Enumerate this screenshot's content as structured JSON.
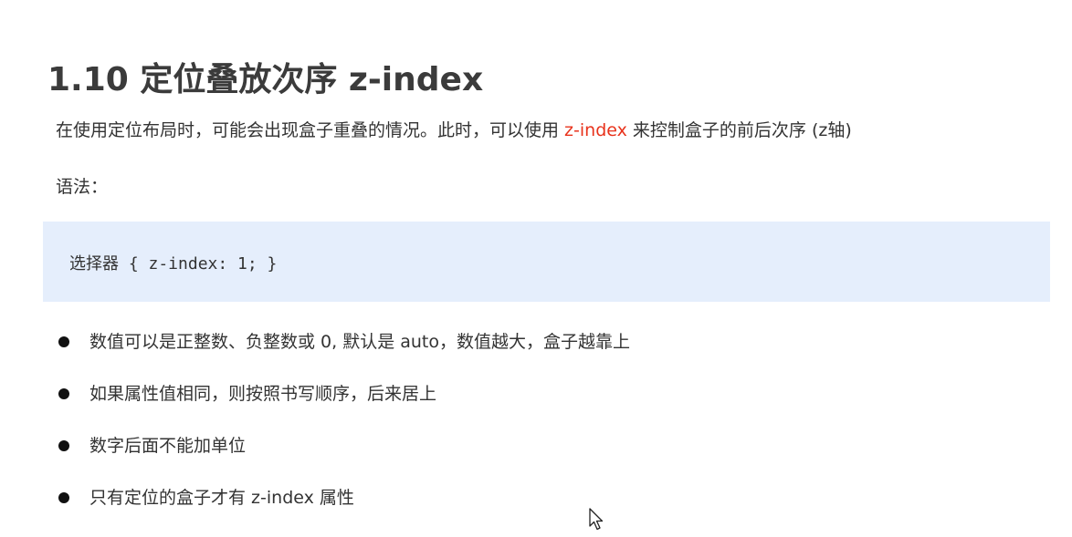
{
  "title": "1.10 定位叠放次序 z-index",
  "intro": {
    "before": "在使用定位布局时，可能会出现盒子重叠的情况。此时，可以使用 ",
    "highlight": "z-index",
    "after": " 来控制盒子的前后次序 (z轴)"
  },
  "syntax_label": "语法：",
  "code": "选择器 { z-index: 1; }",
  "bullets": [
    "数值可以是正整数、负整数或 0, 默认是 auto，数值越大，盒子越靠上",
    "如果属性值相同，则按照书写顺序，后来居上",
    "数字后面不能加单位",
    "只有定位的盒子才有 z-index 属性"
  ],
  "colors": {
    "highlight": "#e8331c",
    "code_background": "#e5eefc",
    "title": "#3b3b3b"
  },
  "icons": {
    "cursor": "mouse-pointer-icon"
  }
}
